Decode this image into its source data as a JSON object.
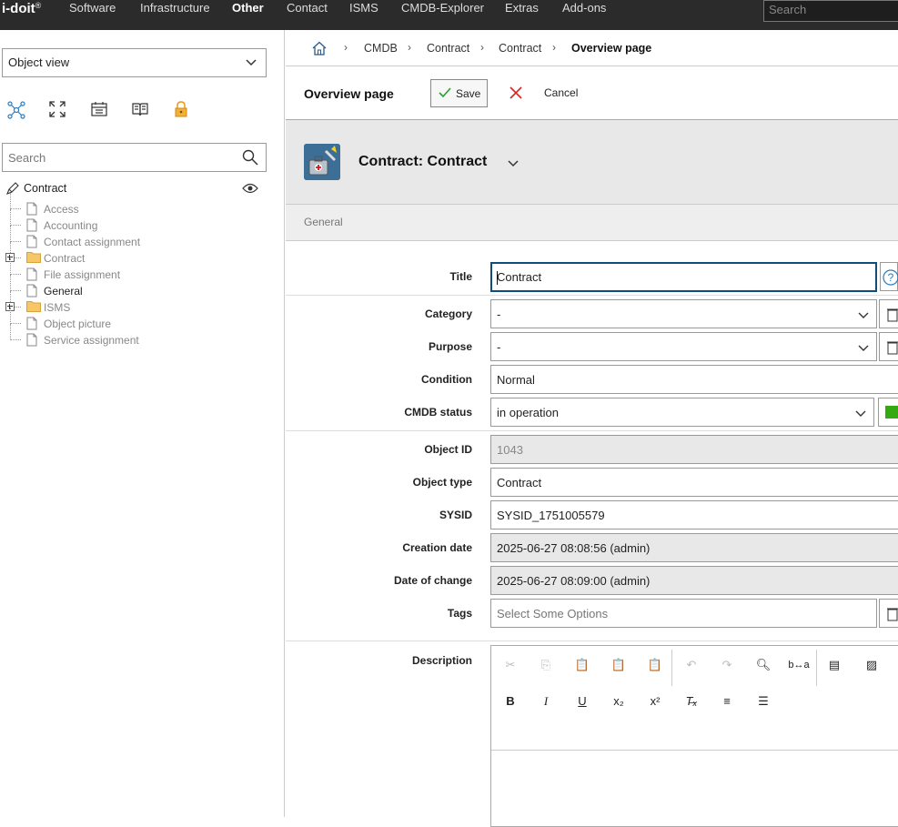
{
  "topnav": {
    "logo": "i-doit",
    "items": [
      "Software",
      "Infrastructure",
      "Other",
      "Contact",
      "ISMS",
      "CMDB-Explorer",
      "Extras",
      "Add-ons"
    ],
    "active": "Other",
    "search_placeholder": "Search"
  },
  "sidebar": {
    "view_select": "Object view",
    "search_placeholder": "Search",
    "root_label": "Contract",
    "tree": [
      {
        "label": "Access",
        "type": "file"
      },
      {
        "label": "Accounting",
        "type": "file"
      },
      {
        "label": "Contact assignment",
        "type": "file"
      },
      {
        "label": "Contract",
        "type": "folder"
      },
      {
        "label": "File assignment",
        "type": "file"
      },
      {
        "label": "General",
        "type": "file"
      },
      {
        "label": "ISMS",
        "type": "folder"
      },
      {
        "label": "Object picture",
        "type": "file"
      },
      {
        "label": "Service assignment",
        "type": "file"
      }
    ]
  },
  "breadcrumb": [
    "CMDB",
    "Contract",
    "Contract",
    "Overview page"
  ],
  "actions": {
    "page_title": "Overview page",
    "save_label": "Save",
    "cancel_label": "Cancel"
  },
  "object": {
    "title": "Contract: Contract",
    "category": "General"
  },
  "form": {
    "title_label": "Title",
    "title_value": "Contract",
    "category_label": "Category",
    "category_value": "-",
    "purpose_label": "Purpose",
    "purpose_value": "-",
    "condition_label": "Condition",
    "condition_value": "Normal",
    "cmdb_status_label": "CMDB status",
    "cmdb_status_value": "in operation",
    "cmdb_status_color": "#33aa11",
    "object_id_label": "Object ID",
    "object_id_value": "1043",
    "object_type_label": "Object type",
    "object_type_value": "Contract",
    "sysid_label": "SYSID",
    "sysid_value": "SYSID_1751005579",
    "creation_label": "Creation date",
    "creation_value": "2025-06-27 08:08:56 (admin)",
    "change_label": "Date of change",
    "change_value": "2025-06-27 08:09:00 (admin)",
    "tags_label": "Tags",
    "tags_placeholder": "Select Some Options",
    "description_label": "Description"
  }
}
